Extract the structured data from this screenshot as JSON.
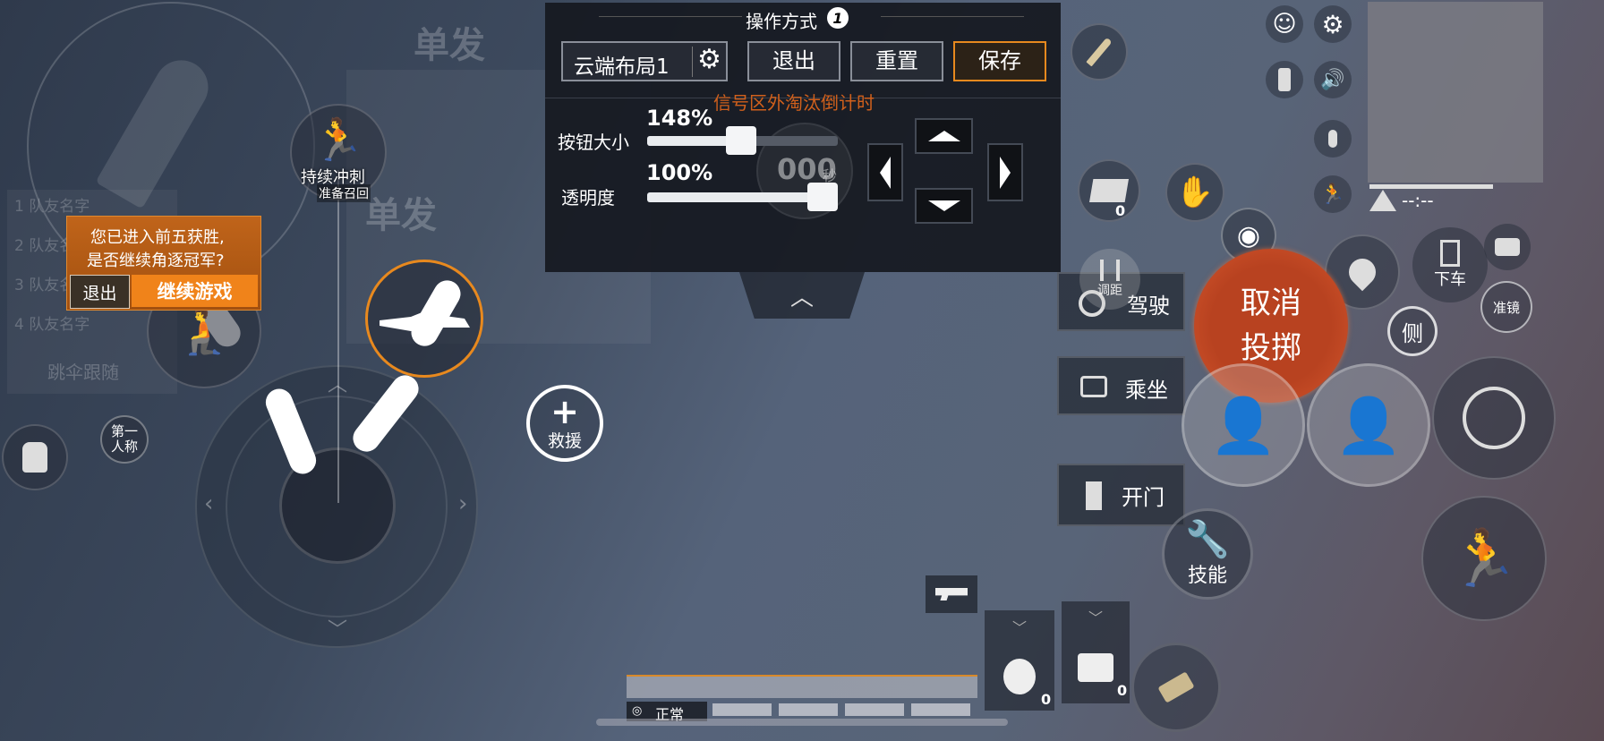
{
  "panel": {
    "title": "操作方式",
    "title_badge": "1",
    "layout_select": "云端布局1",
    "exit_label": "退出",
    "reset_label": "重置",
    "save_label": "保存",
    "countdown_text": "信号区外淘汰倒计时",
    "countdown_value": "000",
    "countdown_unit": "秒",
    "button_size_label": "按钮大小",
    "button_size_value": "148%",
    "button_size_fraction": 0.49,
    "opacity_label": "透明度",
    "opacity_value": "100%",
    "opacity_fraction": 1.0
  },
  "ghost": {
    "single_fire_1": "单发",
    "single_fire_2": "单发",
    "follow_parachute": "跳伞跟随",
    "teammates": [
      "1 队友名字",
      "2 队友名字",
      "3 队友名字",
      "4 队友名字"
    ]
  },
  "top5_dialog": {
    "message_line1": "您已进入前五获胜,",
    "message_line2": "是否继续角逐冠军?",
    "exit_label": "退出",
    "continue_label": "继续游戏"
  },
  "left": {
    "sprint_label": "持续冲刺",
    "recall_label": "准备召回",
    "first_person_label_line1": "第一",
    "first_person_label_line2": "人称"
  },
  "center": {
    "rescue_label": "救援"
  },
  "right": {
    "drive_label": "驾驶",
    "drive_adjust_label": "调距",
    "ride_label": "乘坐",
    "open_door_label": "开门",
    "skill_label": "技能",
    "cancel_throw_line1": "取消",
    "cancel_throw_line2": "投掷",
    "exit_vehicle_label": "下车",
    "scope_label": "准镜",
    "side_label": "侧",
    "supply_count": "0",
    "grenade_count": "0",
    "medkit_count": "0",
    "signal_time": "--:--"
  },
  "bottom": {
    "network_status": "正常"
  },
  "colors": {
    "accent_orange": "#e8891e",
    "cancel_red": "#c4441f",
    "countdown_orange": "#d0601c"
  }
}
